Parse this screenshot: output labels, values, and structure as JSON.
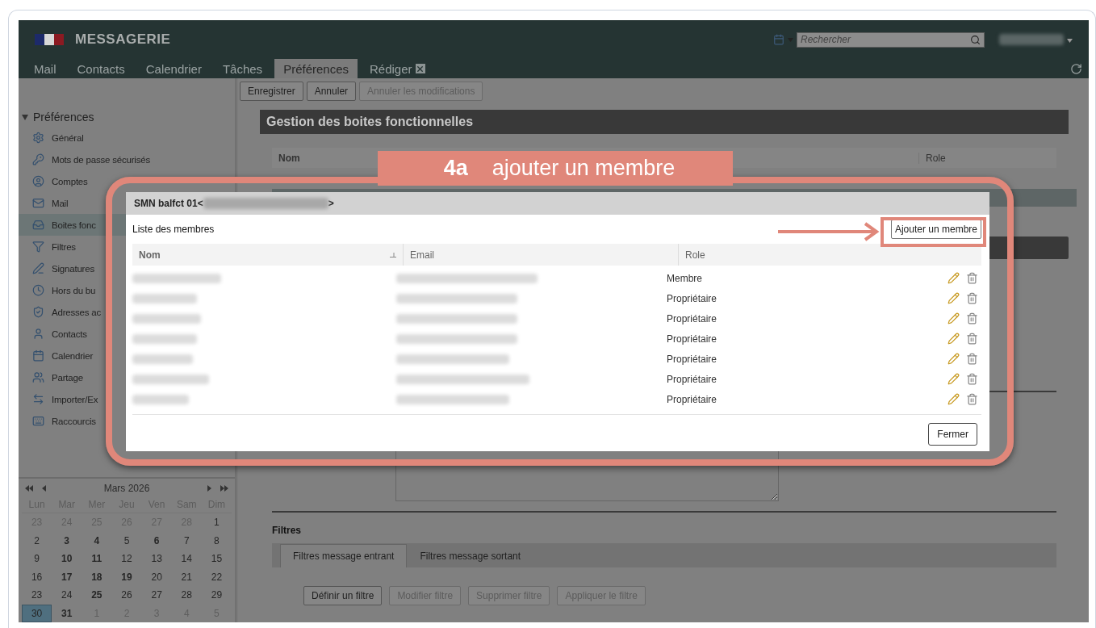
{
  "header": {
    "brand": "MESSAGERIE",
    "search": {
      "placeholder": "Rechercher"
    }
  },
  "tabs": [
    {
      "label": "Mail",
      "selected": false,
      "closable": false
    },
    {
      "label": "Contacts",
      "selected": false,
      "closable": false
    },
    {
      "label": "Calendrier",
      "selected": false,
      "closable": false
    },
    {
      "label": "Tâches",
      "selected": false,
      "closable": false
    },
    {
      "label": "Préférences",
      "selected": true,
      "closable": false
    },
    {
      "label": "Rédiger",
      "selected": false,
      "closable": true
    }
  ],
  "toolbar": [
    {
      "label": "Enregistrer",
      "disabled": false
    },
    {
      "label": "Annuler",
      "disabled": false
    },
    {
      "label": "Annuler les modifications",
      "disabled": true
    }
  ],
  "sidebar": {
    "title": "Préférences",
    "expanded": true,
    "items": [
      {
        "label": "Général",
        "selected": false
      },
      {
        "label": "Mots de passe sécurisés",
        "selected": false
      },
      {
        "label": "Comptes",
        "selected": false
      },
      {
        "label": "Mail",
        "selected": false
      },
      {
        "label": "Boites fonc",
        "selected": true
      },
      {
        "label": "Filtres",
        "selected": false
      },
      {
        "label": "Signatures",
        "selected": false
      },
      {
        "label": "Hors du bu",
        "selected": false
      },
      {
        "label": "Adresses ac",
        "selected": false
      },
      {
        "label": "Contacts",
        "selected": false
      },
      {
        "label": "Calendrier",
        "selected": false
      },
      {
        "label": "Partage",
        "selected": false
      },
      {
        "label": "Importer/Ex",
        "selected": false
      },
      {
        "label": "Raccourcis",
        "selected": false
      }
    ]
  },
  "calendar": {
    "month": "Mars 2026",
    "weekdays": [
      "Lun",
      "Mar",
      "Mer",
      "Jeu",
      "Ven",
      "Sam",
      "Dim"
    ],
    "days": [
      {
        "day": "23",
        "muted": true,
        "bold": false,
        "selected": false
      },
      {
        "day": "24",
        "muted": true,
        "bold": false,
        "selected": false
      },
      {
        "day": "25",
        "muted": true,
        "bold": false,
        "selected": false
      },
      {
        "day": "26",
        "muted": true,
        "bold": false,
        "selected": false
      },
      {
        "day": "27",
        "muted": true,
        "bold": false,
        "selected": false
      },
      {
        "day": "28",
        "muted": true,
        "bold": false,
        "selected": false
      },
      {
        "day": "1",
        "muted": false,
        "bold": false,
        "selected": false
      },
      {
        "day": "2",
        "muted": false,
        "bold": false,
        "selected": false
      },
      {
        "day": "3",
        "muted": false,
        "bold": true,
        "selected": false
      },
      {
        "day": "4",
        "muted": false,
        "bold": true,
        "selected": false
      },
      {
        "day": "5",
        "muted": false,
        "bold": false,
        "selected": false
      },
      {
        "day": "6",
        "muted": false,
        "bold": true,
        "selected": false
      },
      {
        "day": "7",
        "muted": false,
        "bold": false,
        "selected": false
      },
      {
        "day": "8",
        "muted": false,
        "bold": false,
        "selected": false
      },
      {
        "day": "9",
        "muted": false,
        "bold": false,
        "selected": false
      },
      {
        "day": "10",
        "muted": false,
        "bold": true,
        "selected": false
      },
      {
        "day": "11",
        "muted": false,
        "bold": true,
        "selected": false
      },
      {
        "day": "12",
        "muted": false,
        "bold": false,
        "selected": false
      },
      {
        "day": "13",
        "muted": false,
        "bold": false,
        "selected": false
      },
      {
        "day": "14",
        "muted": false,
        "bold": false,
        "selected": false
      },
      {
        "day": "15",
        "muted": false,
        "bold": false,
        "selected": false
      },
      {
        "day": "16",
        "muted": false,
        "bold": false,
        "selected": false
      },
      {
        "day": "17",
        "muted": false,
        "bold": true,
        "selected": false
      },
      {
        "day": "18",
        "muted": false,
        "bold": true,
        "selected": false
      },
      {
        "day": "19",
        "muted": false,
        "bold": true,
        "selected": false
      },
      {
        "day": "20",
        "muted": false,
        "bold": false,
        "selected": false
      },
      {
        "day": "21",
        "muted": false,
        "bold": false,
        "selected": false
      },
      {
        "day": "22",
        "muted": false,
        "bold": false,
        "selected": false
      },
      {
        "day": "23",
        "muted": false,
        "bold": false,
        "selected": false
      },
      {
        "day": "24",
        "muted": false,
        "bold": false,
        "selected": false
      },
      {
        "day": "25",
        "muted": false,
        "bold": true,
        "selected": false
      },
      {
        "day": "26",
        "muted": false,
        "bold": false,
        "selected": false
      },
      {
        "day": "27",
        "muted": false,
        "bold": false,
        "selected": false
      },
      {
        "day": "28",
        "muted": false,
        "bold": false,
        "selected": false
      },
      {
        "day": "29",
        "muted": false,
        "bold": false,
        "selected": false
      },
      {
        "day": "30",
        "muted": false,
        "bold": false,
        "selected": true
      },
      {
        "day": "31",
        "muted": false,
        "bold": true,
        "selected": false
      },
      {
        "day": "1",
        "muted": true,
        "bold": false,
        "selected": false
      },
      {
        "day": "2",
        "muted": true,
        "bold": false,
        "selected": false
      },
      {
        "day": "3",
        "muted": true,
        "bold": false,
        "selected": false
      },
      {
        "day": "4",
        "muted": true,
        "bold": false,
        "selected": false
      },
      {
        "day": "5",
        "muted": true,
        "bold": false,
        "selected": false
      }
    ]
  },
  "main": {
    "section_title": "Gestion des boites fonctionnelles",
    "columns": [
      "Nom",
      "Role"
    ],
    "filters": {
      "title": "Filtres",
      "tabs": [
        {
          "label": "Filtres message entrant",
          "selected": true
        },
        {
          "label": "Filtres message sortant",
          "selected": false
        }
      ],
      "buttons": [
        {
          "label": "Définir un filtre",
          "disabled": false
        },
        {
          "label": "Modifier filtre",
          "disabled": true
        },
        {
          "label": "Supprimer filtre",
          "disabled": true
        },
        {
          "label": "Appliquer le filtre",
          "disabled": true
        }
      ]
    }
  },
  "dialog": {
    "title": "SMN balfct 01<",
    "title_end": ">",
    "list_title": "Liste des membres",
    "add_button": "Ajouter un membre",
    "columns": [
      "Nom",
      "Email",
      "Role"
    ],
    "members": [
      {
        "role": "Membre"
      },
      {
        "role": "Propriétaire"
      },
      {
        "role": "Propriétaire"
      },
      {
        "role": "Propriétaire"
      },
      {
        "role": "Propriétaire"
      },
      {
        "role": "Propriétaire"
      },
      {
        "role": "Propriétaire"
      }
    ],
    "close_button": "Fermer"
  },
  "annotation": {
    "step": "4a",
    "text": "ajouter un membre"
  }
}
